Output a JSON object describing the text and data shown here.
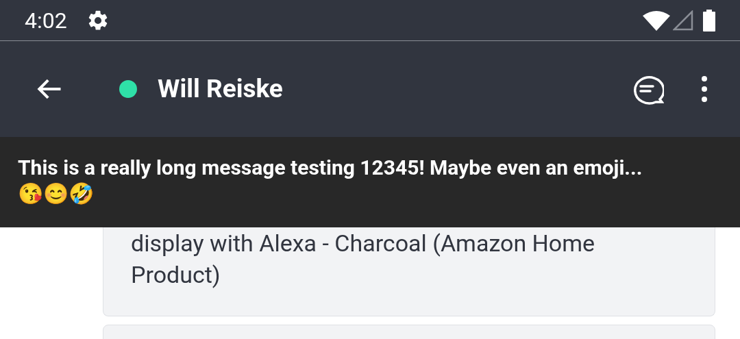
{
  "status_bar": {
    "time": "4:02"
  },
  "app_bar": {
    "title": "Will Reiske",
    "online": true
  },
  "banner": {
    "text": "This is a really long message testing 12345! Maybe even an emoji... 😘😊🤣"
  },
  "messages": [
    {
      "kind": "text",
      "text": "display with Alexa - Charcoal (Amazon Home Product)"
    },
    {
      "kind": "cut"
    }
  ]
}
